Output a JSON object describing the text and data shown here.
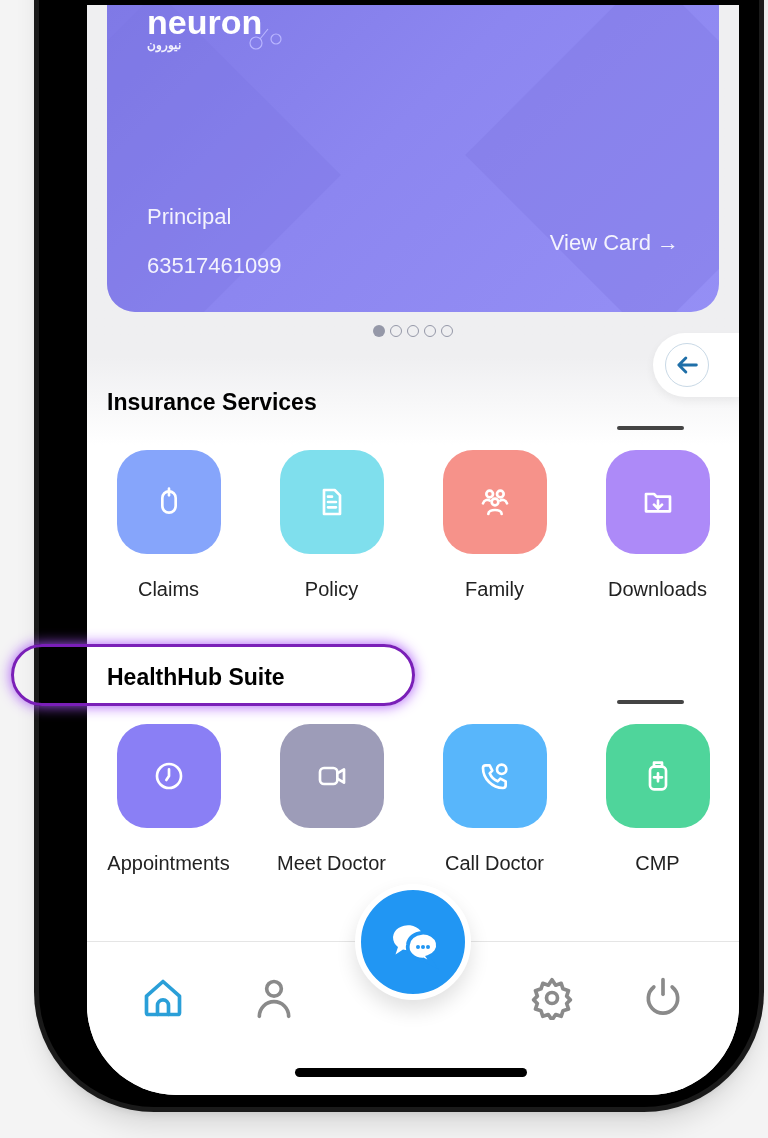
{
  "card": {
    "logo": "neuron",
    "logo_arabic": "نيورون",
    "holder_type": "Principal",
    "card_number": "63517461099",
    "link": "View Card →"
  },
  "pager": [
    {
      "selected": true
    },
    {
      "selected": false
    },
    {
      "selected": false
    },
    {
      "selected": false
    },
    {
      "selected": false
    }
  ],
  "sections": [
    {
      "title": "Insurance Services",
      "highlighted": false,
      "items": [
        {
          "label": "Claims",
          "kind": "mouse",
          "color": "#86a5fb"
        },
        {
          "label": "Policy",
          "kind": "document",
          "color": "#7fdfed"
        },
        {
          "label": "Family",
          "kind": "people",
          "color": "#f6928a"
        },
        {
          "label": "Downloads",
          "kind": "folder",
          "color": "#ad8af8"
        }
      ]
    },
    {
      "title": "HealthHub Suite",
      "highlighted": true,
      "items": [
        {
          "label": "Appointments",
          "kind": "clock",
          "color": "#8a7ff5"
        },
        {
          "label": "Meet Doctor",
          "kind": "video",
          "color": "#9d9cb8"
        },
        {
          "label": "Call Doctor",
          "kind": "phone",
          "color": "#58b6fb"
        },
        {
          "label": "CMP",
          "kind": "bottle",
          "color": "#4fd59b"
        }
      ]
    }
  ],
  "nav": [
    {
      "kind": "home",
      "selected": true
    },
    {
      "kind": "user",
      "selected": false
    },
    {
      "kind": "chat",
      "selected": false
    },
    {
      "kind": "gear",
      "selected": false
    },
    {
      "kind": "power",
      "selected": false
    }
  ]
}
